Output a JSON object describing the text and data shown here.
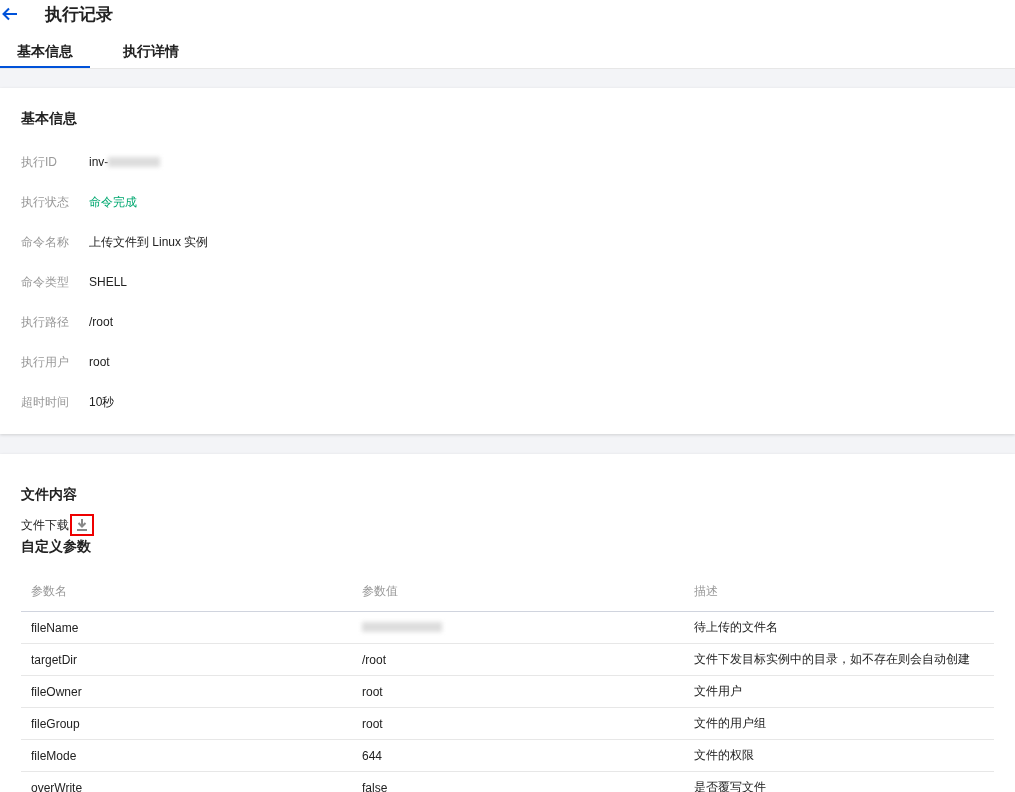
{
  "header": {
    "title": "执行记录"
  },
  "tabs": [
    {
      "label": "基本信息",
      "selected": true
    },
    {
      "label": "执行详情",
      "selected": false
    }
  ],
  "basic_info": {
    "title": "基本信息",
    "fields": [
      {
        "label": "执行ID",
        "value": "inv-",
        "kind": "redacted"
      },
      {
        "label": "执行状态",
        "value": "命令完成",
        "kind": "status"
      },
      {
        "label": "命令名称",
        "value": "上传文件到 Linux 实例",
        "kind": "text"
      },
      {
        "label": "命令类型",
        "value": "SHELL",
        "kind": "text"
      },
      {
        "label": "执行路径",
        "value": "/root",
        "kind": "text"
      },
      {
        "label": "执行用户",
        "value": "root",
        "kind": "text"
      },
      {
        "label": "超时时间",
        "value": "10秒",
        "kind": "text"
      }
    ]
  },
  "file_content": {
    "title": "文件内容",
    "download_label": "文件下载",
    "download_highlighted": true
  },
  "custom_params": {
    "title": "自定义参数",
    "table": {
      "columns": [
        "参数名",
        "参数值",
        "描述"
      ],
      "rows": [
        {
          "name": "fileName",
          "value": "",
          "value_redacted": true,
          "description": "待上传的文件名"
        },
        {
          "name": "targetDir",
          "value": "/root",
          "value_redacted": false,
          "description": "文件下发目标实例中的目录，如不存在则会自动创建"
        },
        {
          "name": "fileOwner",
          "value": "root",
          "value_redacted": false,
          "description": "文件用户"
        },
        {
          "name": "fileGroup",
          "value": "root",
          "value_redacted": false,
          "description": "文件的用户组"
        },
        {
          "name": "fileMode",
          "value": "644",
          "value_redacted": false,
          "description": "文件的权限"
        },
        {
          "name": "overWrite",
          "value": "false",
          "value_redacted": false,
          "description": "是否覆写文件"
        }
      ]
    }
  }
}
